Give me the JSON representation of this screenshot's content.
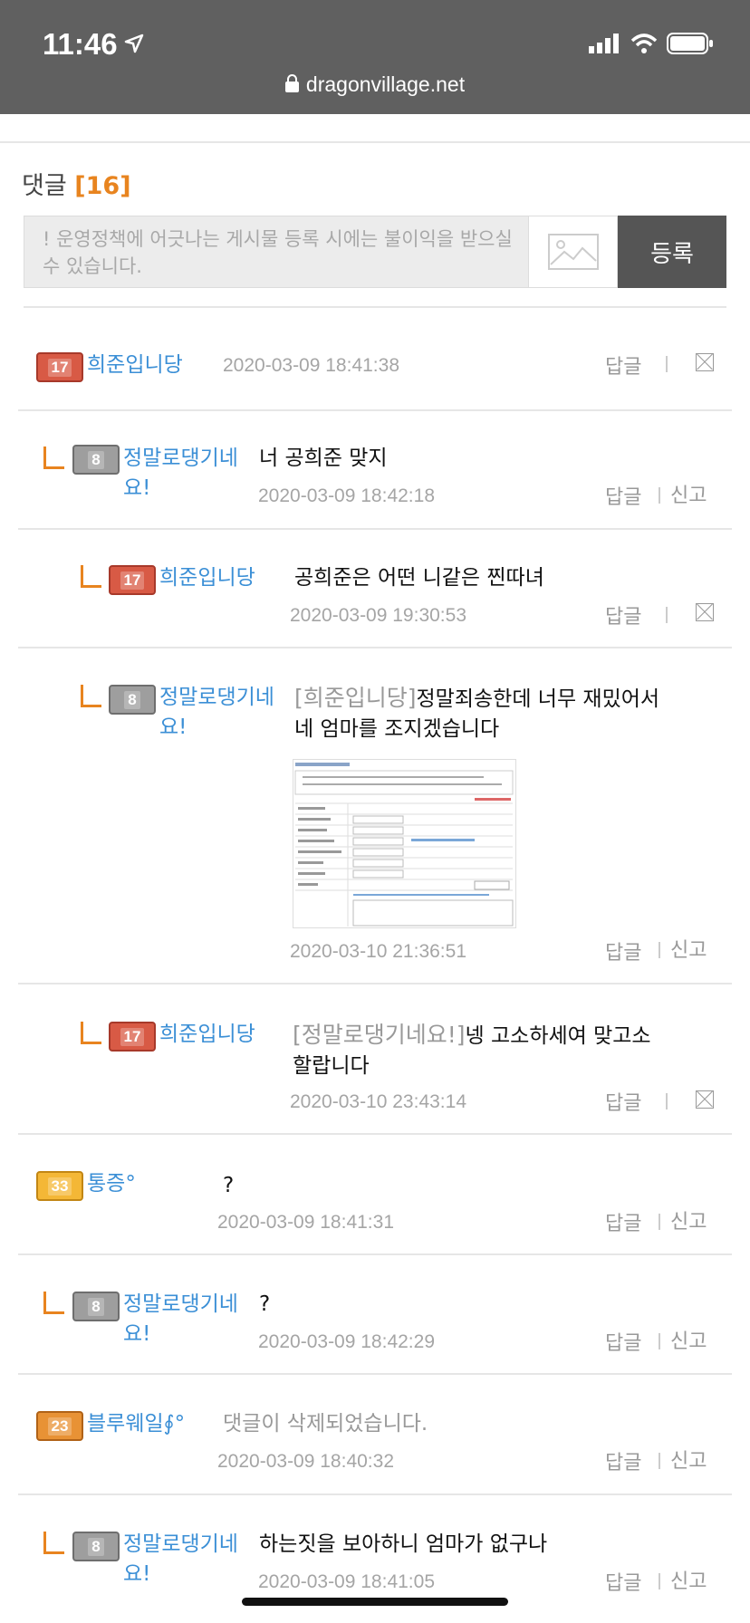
{
  "status_bar": {
    "time": "11:46",
    "url": "dragonvillage.net"
  },
  "comments_section": {
    "title": "댓글",
    "count": "[16]",
    "input_placeholder": "! 운영정책에 어긋나는 게시물 등록 시에는 불이익을 받으실 수 있습니다.",
    "submit_label": "등록"
  },
  "actions": {
    "reply": "답글",
    "report": "신고"
  },
  "badges": {
    "b17": "17",
    "b8": "8",
    "b33": "33",
    "b23": "23"
  },
  "comments": [
    {
      "author": "희준입니당",
      "text": "",
      "date": "2020-03-09 18:41:38"
    },
    {
      "author_line1": "정말로댕기네",
      "author_line2": "요!",
      "text": "너 공희준 맞지",
      "date": "2020-03-09 18:42:18"
    },
    {
      "author": "희준입니당",
      "text": "공희준은 어떤 니같은 찐따녀",
      "date": "2020-03-09 19:30:53"
    },
    {
      "author_line1": "정말로댕기네",
      "author_line2": "요!",
      "tag": "[희준입니당]",
      "text_line1": "정말죄송한데 너무 재밌어서",
      "text_line2": "네 엄마를 조지겠습니다",
      "date": "2020-03-10 21:36:51"
    },
    {
      "author": "희준입니당",
      "tag": "[정말로댕기네요!]",
      "text_line1": "넹 고소하세여 맞고소",
      "text_line2": "할랍니다",
      "date": "2020-03-10 23:43:14"
    },
    {
      "author": "통증°",
      "text": "?",
      "date": "2020-03-09 18:41:31"
    },
    {
      "author_line1": "정말로댕기네",
      "author_line2": "요!",
      "text": "?",
      "date": "2020-03-09 18:42:29"
    },
    {
      "author": "블루웨일∮°",
      "text": "댓글이 삭제되었습니다.",
      "date": "2020-03-09 18:40:32"
    },
    {
      "author_line1": "정말로댕기네",
      "author_line2": "요!",
      "text": "하는짓을 보아하니 엄마가 없구나",
      "date": "2020-03-09 18:41:05"
    }
  ]
}
